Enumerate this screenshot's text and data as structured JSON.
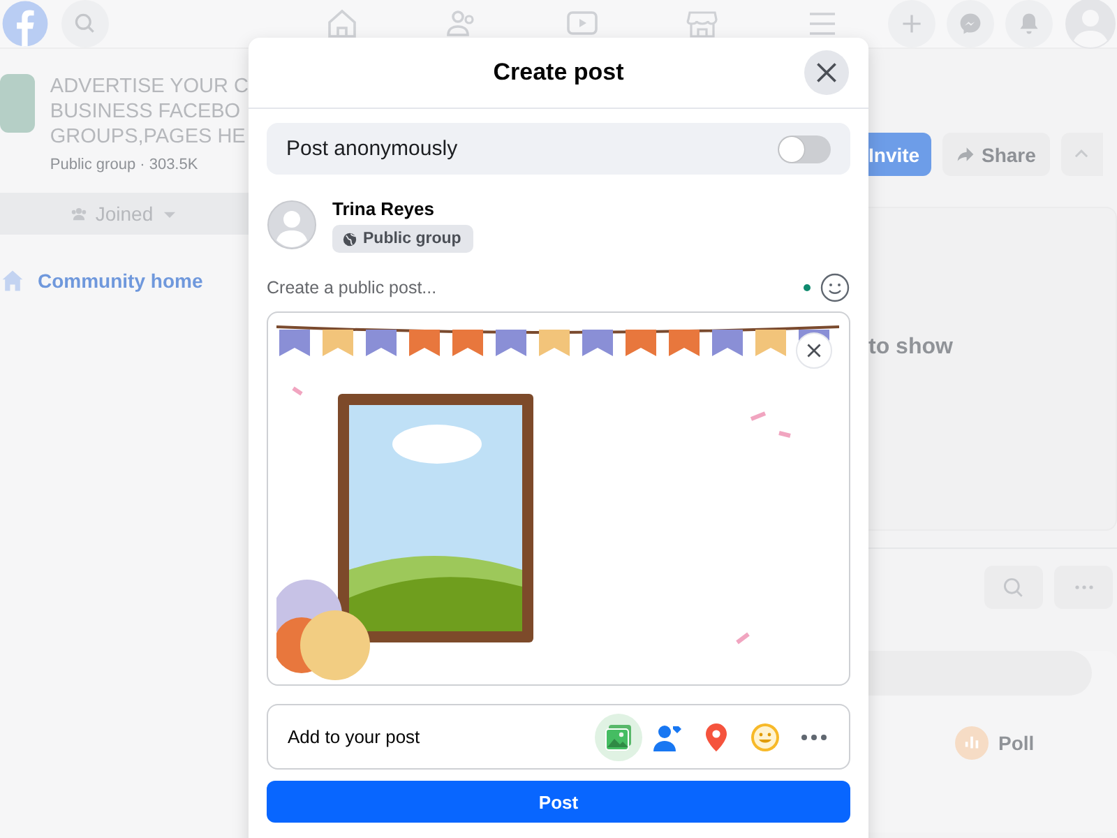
{
  "group": {
    "title_lines": [
      "ADVERTISE YOUR C",
      "BUSINESS FACEBO",
      "GROUPS,PAGES HE"
    ],
    "meta": "Public group · 303.5K",
    "joined": "Joined",
    "community": "Community home"
  },
  "right": {
    "invite": "Invite",
    "share": "Share",
    "empty_text": "to show",
    "poll": "Poll"
  },
  "dialog": {
    "title": "Create post",
    "anonymous": {
      "label": "Post anonymously",
      "on": false
    },
    "author": {
      "name": "Trina Reyes",
      "audience": "Public group"
    },
    "composer": {
      "placeholder": "Create a public post..."
    },
    "add_to_post": {
      "label": "Add to your post",
      "tools": [
        {
          "kind": "photo",
          "selected": true
        },
        {
          "kind": "tag",
          "selected": false
        },
        {
          "kind": "location",
          "selected": false
        },
        {
          "kind": "feeling",
          "selected": false
        },
        {
          "kind": "more",
          "selected": false
        }
      ]
    },
    "post_button": "Post"
  }
}
